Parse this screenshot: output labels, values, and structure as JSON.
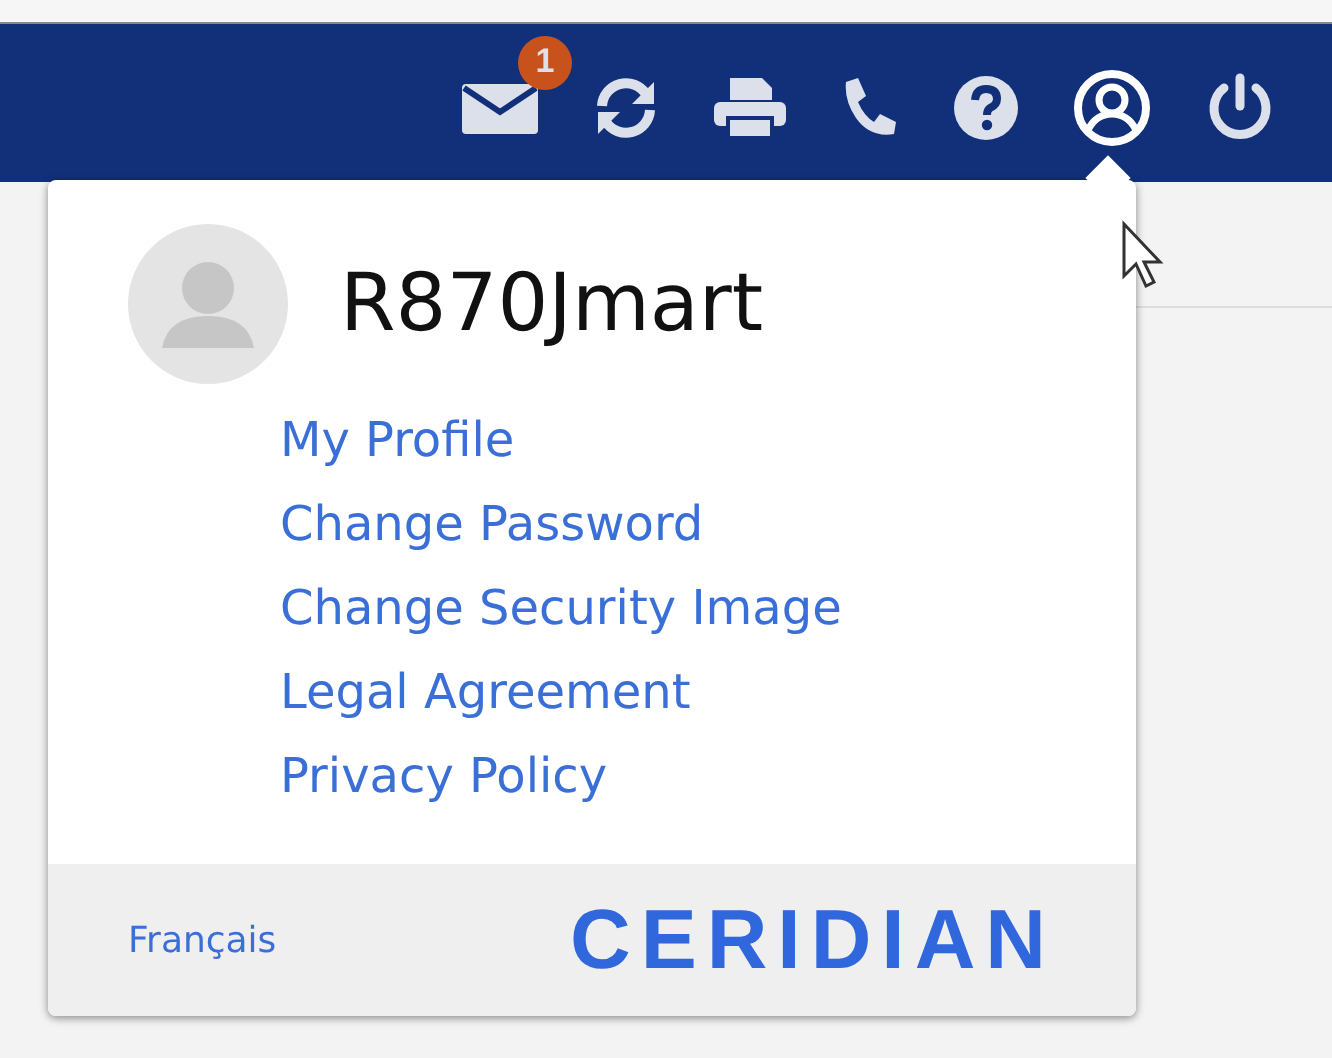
{
  "toolbar": {
    "icons": [
      {
        "kind": "mail",
        "badge": "1"
      },
      {
        "kind": "refresh"
      },
      {
        "kind": "print"
      },
      {
        "kind": "phone"
      },
      {
        "kind": "help"
      },
      {
        "kind": "user",
        "selected": true
      },
      {
        "kind": "power"
      }
    ]
  },
  "menu": {
    "username": "R870Jmart",
    "links": [
      "My Profile",
      "Change Password",
      "Change Security Image",
      "Legal Agreement",
      "Privacy Policy"
    ],
    "language": "Français",
    "logo": "CERIDIAN"
  }
}
